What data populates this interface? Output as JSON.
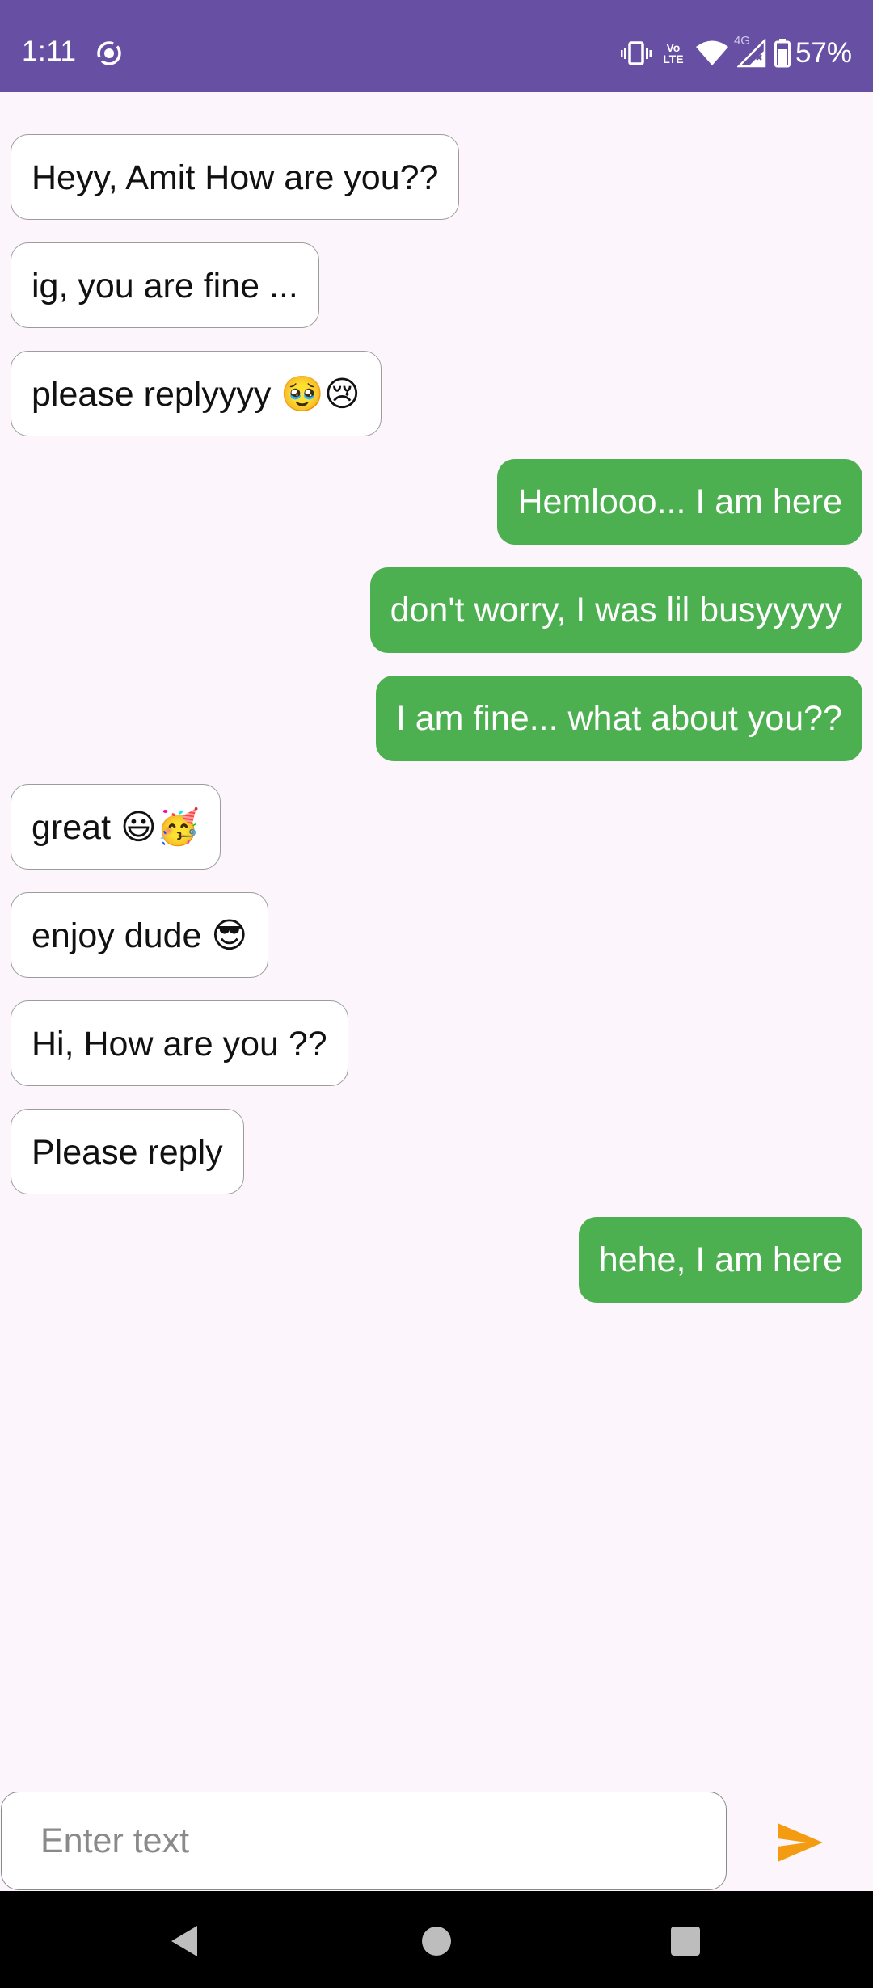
{
  "status_bar": {
    "time": "1:11",
    "battery_percent": "57%",
    "lte_top": "Vo",
    "lte_bottom": "LTE",
    "network_type": "4G",
    "background_color": "#6750A4"
  },
  "messages": [
    {
      "side": "in",
      "text": "Heyy, Amit How are you??"
    },
    {
      "side": "in",
      "text": "ig, you are fine ..."
    },
    {
      "side": "in",
      "text": "please replyyyy 🥹😢"
    },
    {
      "side": "out",
      "text": "Hemlooo... I am here"
    },
    {
      "side": "out",
      "text": "don't worry, I was lil busyyyyy"
    },
    {
      "side": "out",
      "text": "I am fine... what about you??"
    },
    {
      "side": "in",
      "text": "great 😃🥳"
    },
    {
      "side": "in",
      "text": "enjoy dude 😎"
    },
    {
      "side": "in",
      "text": "Hi, How are you ??"
    },
    {
      "side": "in",
      "text": "Please reply"
    },
    {
      "side": "out",
      "text": "hehe, I am here"
    }
  ],
  "composer": {
    "placeholder": "Enter text",
    "value": "",
    "send_icon": "send-icon",
    "send_color": "#F39C12"
  },
  "colors": {
    "background": "#FCF5FC",
    "outgoing_bubble": "#4CAF50",
    "incoming_bubble": "#FFFFFF"
  },
  "nav_bar": {
    "back_icon": "back-triangle-icon",
    "home_icon": "home-circle-icon",
    "recents_icon": "recents-square-icon"
  }
}
